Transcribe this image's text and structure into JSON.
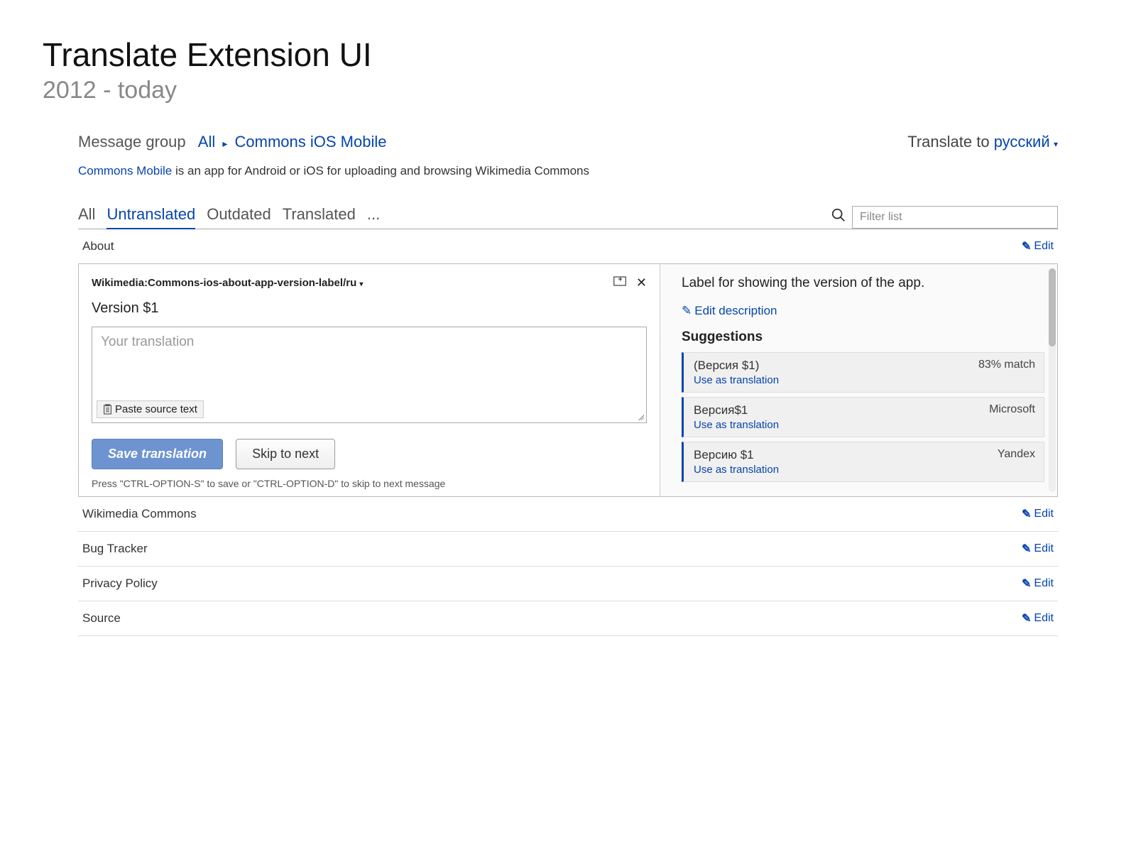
{
  "slide": {
    "title": "Translate Extension UI",
    "subtitle": "2012 - today"
  },
  "header": {
    "msgGroupLabel": "Message group",
    "allLabel": "All",
    "crumb": "Commons iOS Mobile",
    "translateToLabel": "Translate to",
    "language": "русский"
  },
  "desc": {
    "link": "Commons Mobile",
    "rest": " is an app for Android or iOS for uploading and browsing Wikimedia Commons"
  },
  "tabs": {
    "all": "All",
    "untranslated": "Untranslated",
    "outdated": "Outdated",
    "translated": "Translated",
    "more": "..."
  },
  "filter": {
    "placeholder": "Filter list"
  },
  "rows": {
    "about": "About",
    "wc": "Wikimedia Commons",
    "bug": "Bug Tracker",
    "pp": "Privacy Policy",
    "src": "Source",
    "edit": "Edit"
  },
  "editor": {
    "key": "Wikimedia:Commons-ios-about-app-version-label/ru",
    "source": "Version $1",
    "placeholder": "Your translation",
    "paste": "Paste source text",
    "save": "Save translation",
    "skip": "Skip to next",
    "hint": "Press \"CTRL-OPTION-S\" to save or \"CTRL-OPTION-D\" to skip to next message"
  },
  "right": {
    "desc": "Label for showing the version of the app.",
    "editDesc": "Edit description",
    "sugg": "Suggestions",
    "items": [
      {
        "text": "(Версия $1)",
        "meta": "83% match",
        "use": "Use as translation"
      },
      {
        "text": "Версия$1",
        "meta": "Microsoft",
        "use": "Use as translation"
      },
      {
        "text": "Версию $1",
        "meta": "Yandex",
        "use": "Use as translation"
      }
    ]
  }
}
